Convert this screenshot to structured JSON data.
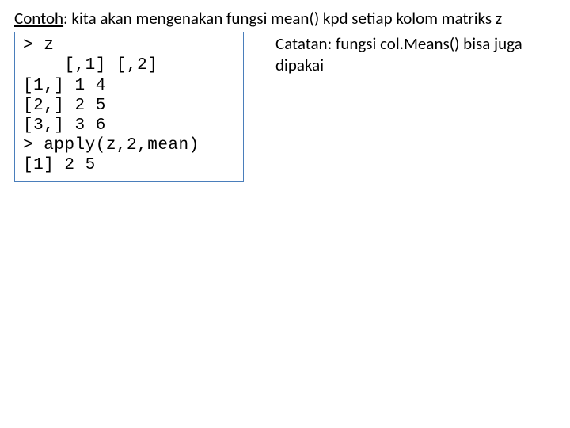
{
  "heading": {
    "label": "Contoh",
    "sep": ": ",
    "text": "kita akan mengenakan fungsi mean() kpd setiap kolom matriks z"
  },
  "code": {
    "lines": [
      "> z",
      "    [,1] [,2]",
      "[1,] 1 4",
      "[2,] 2 5",
      "[3,] 3 6",
      "> apply(z,2,mean)",
      "[1] 2 5"
    ]
  },
  "note": {
    "text": "Catatan: fungsi col.Means() bisa juga dipakai"
  },
  "chart_data": {
    "type": "table",
    "title": "Matrix z and column means via apply()",
    "categories": [
      "[,1]",
      "[,2]"
    ],
    "rows": [
      "[1,]",
      "[2,]",
      "[3,]"
    ],
    "values": [
      [
        1,
        4
      ],
      [
        2,
        5
      ],
      [
        3,
        6
      ]
    ],
    "column_means": [
      2,
      5
    ]
  }
}
